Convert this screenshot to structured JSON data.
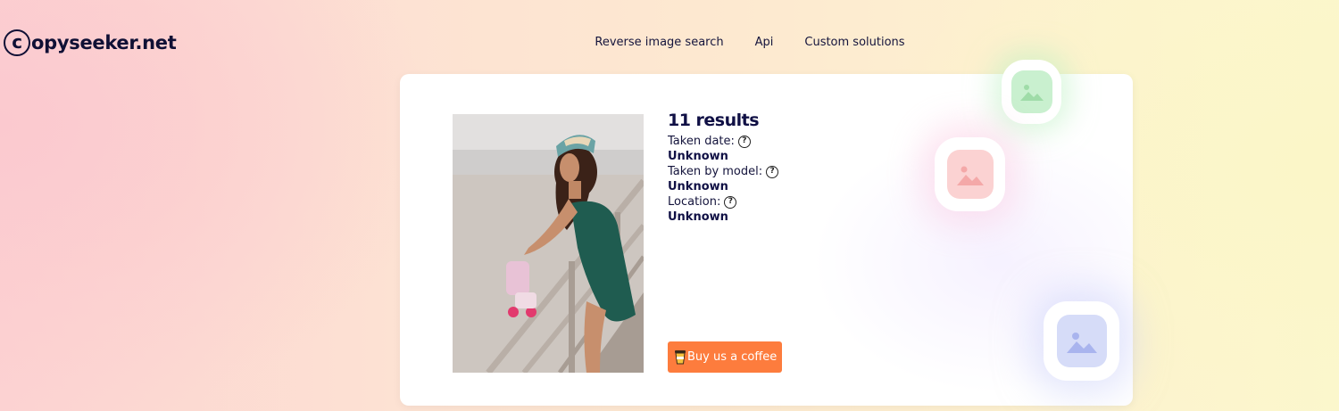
{
  "brand": {
    "logo_letter": "c",
    "logo_rest": "opyseeker.net"
  },
  "nav": {
    "items": [
      "Reverse image search",
      "Api",
      "Custom solutions"
    ]
  },
  "result": {
    "count_label": "11 results",
    "fields": [
      {
        "label": "Taken date:",
        "value": "Unknown"
      },
      {
        "label": "Taken by model:",
        "value": "Unknown"
      },
      {
        "label": "Location:",
        "value": "Unknown"
      }
    ],
    "help_glyph": "?"
  },
  "coffee_button": {
    "label": "Buy us a coffee",
    "icon": "coffee-cup-icon"
  },
  "colors": {
    "accent_orange": "#fd7c3d",
    "text_dark": "#101045",
    "tile_green": "#c9f0cf",
    "tile_pink": "#fbd2d2",
    "tile_blue": "#d6dcf8"
  },
  "icons": [
    "copyright-c-icon",
    "help-circle-icon",
    "coffee-cup-icon",
    "image-placeholder-icon"
  ]
}
